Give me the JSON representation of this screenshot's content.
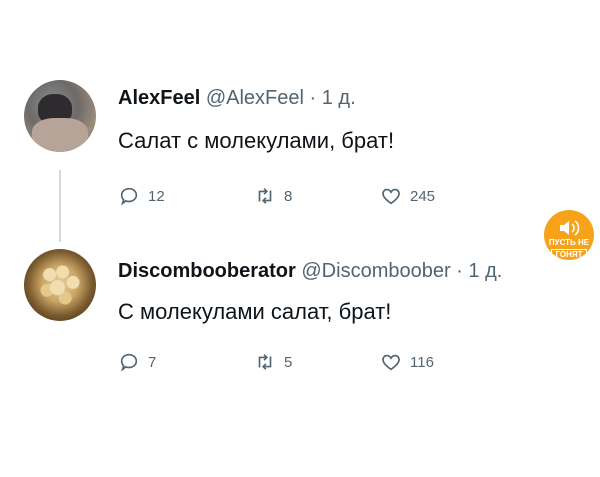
{
  "tweets": [
    {
      "name": "AlexFeel",
      "handle": "@AlexFeel",
      "separator": "·",
      "time": "1 д.",
      "text": "Салат с молекулами, брат!",
      "replies": "12",
      "retweets": "8",
      "likes": "245"
    },
    {
      "name": "Discombooberator",
      "handle": "@Discomboober",
      "separator": "·",
      "time": "1 д.",
      "text": "С молекулами салат, брат!",
      "replies": "7",
      "retweets": "5",
      "likes": "116"
    }
  ],
  "sticker": {
    "line1": "ПУСТЬ НЕ",
    "line2": "ГОНЯТ",
    "icon": "speaker-icon",
    "color": "#f6a31a"
  },
  "icons": {
    "reply": "reply-icon",
    "retweet": "retweet-icon",
    "like": "heart-icon"
  }
}
